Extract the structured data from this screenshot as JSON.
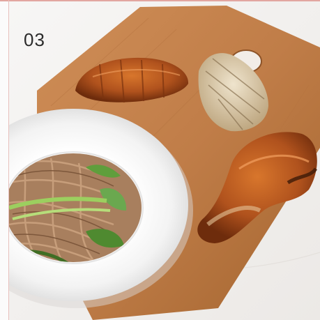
{
  "slide": {
    "number": "03"
  },
  "scene": {
    "icons": [
      "salad-icon",
      "noodles-icon",
      "chicken-icon",
      "board-icon"
    ]
  },
  "colors": {
    "background": "#f4f1ee",
    "board": "#c07d48",
    "board_dark": "#9a5a2c",
    "plate": "#ffffff",
    "noodles": "#a87f5e",
    "greens": "#6aa84f",
    "glaze": "#b0521d",
    "grilled": "#d9c7a3",
    "border": "#e2a6a0"
  }
}
